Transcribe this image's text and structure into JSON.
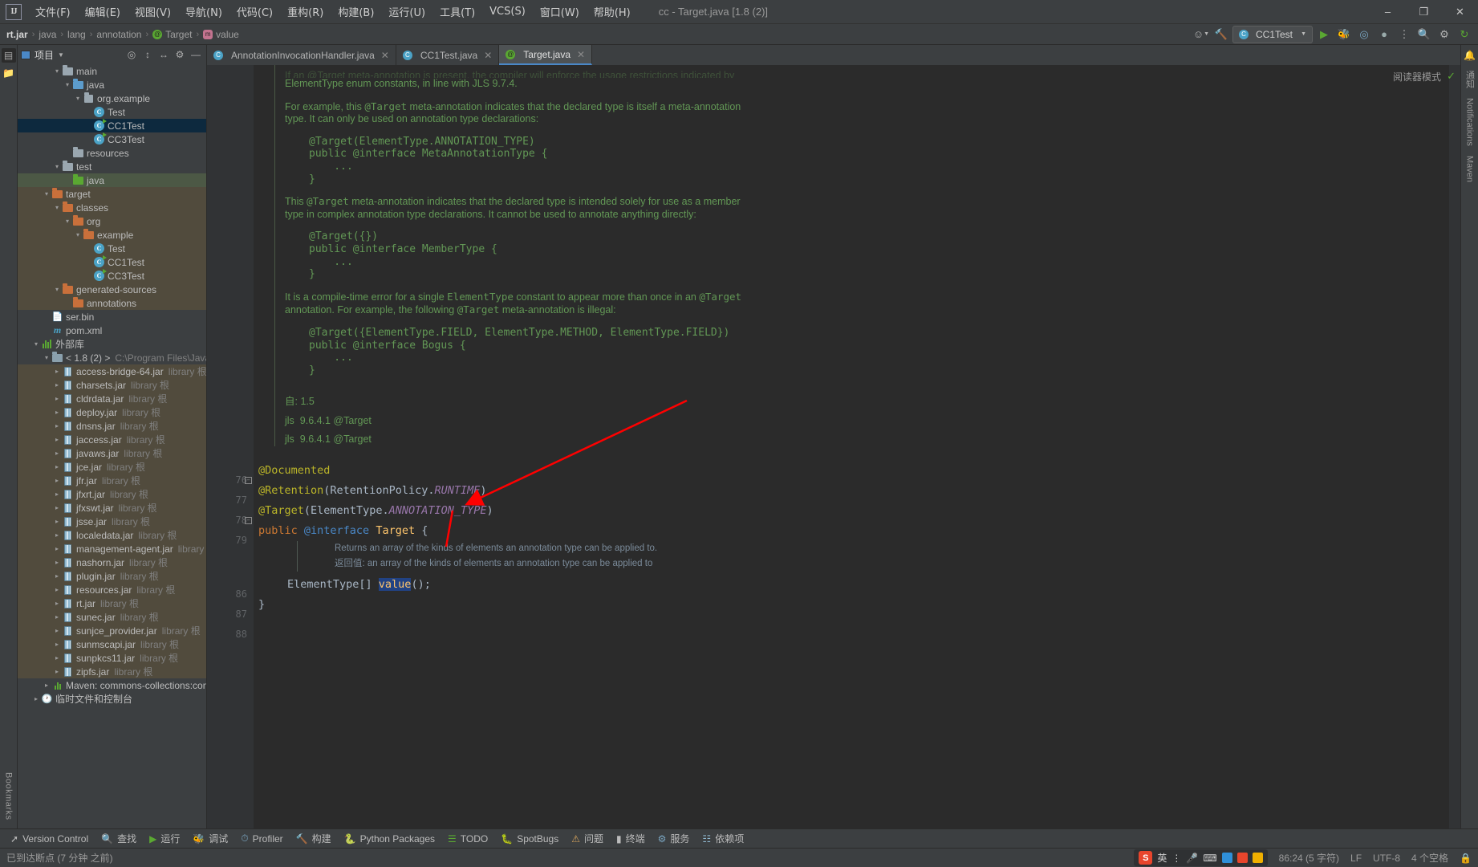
{
  "titlebar": {
    "logo": "IJ",
    "menus": [
      "文件(F)",
      "编辑(E)",
      "视图(V)",
      "导航(N)",
      "代码(C)",
      "重构(R)",
      "构建(B)",
      "运行(U)",
      "工具(T)",
      "VCS(S)",
      "窗口(W)",
      "帮助(H)"
    ],
    "window_title": "cc - Target.java [1.8 (2)]",
    "minimize": "–",
    "maximize": "❐",
    "close": "✕"
  },
  "navbar": {
    "breadcrumbs": [
      {
        "label": "rt.jar",
        "icon": "",
        "bold": true
      },
      {
        "label": "java",
        "icon": ""
      },
      {
        "label": "lang",
        "icon": ""
      },
      {
        "label": "annotation",
        "icon": ""
      },
      {
        "label": "Target",
        "icon": "annotation-icon"
      },
      {
        "label": "value",
        "icon": "method-icon"
      }
    ],
    "separator": "›",
    "run_config": "CC1Test",
    "icons": {
      "profile": "☺",
      "hammer": "⚒",
      "run": "▶",
      "debug": "🐞",
      "coverage": "◉",
      "more": "⋯",
      "search": "🔍",
      "settings": "⚙",
      "updates": "↻"
    }
  },
  "project_panel": {
    "title": "项目",
    "actions": [
      "target-icon",
      "collapse-all-icon",
      "expand-icon",
      "settings-icon",
      "hide-icon"
    ],
    "tree": [
      {
        "indent": 3,
        "arrow": "v",
        "icon": "folder-gray",
        "label": "main",
        "sub": ""
      },
      {
        "indent": 4,
        "arrow": "v",
        "icon": "folder-blue",
        "label": "java",
        "sub": ""
      },
      {
        "indent": 5,
        "arrow": "v",
        "icon": "package-gray",
        "label": "org.example",
        "sub": ""
      },
      {
        "indent": 6,
        "arrow": "",
        "icon": "class",
        "label": "Test",
        "sub": ""
      },
      {
        "indent": 6,
        "arrow": "",
        "icon": "class-run",
        "label": "CC1Test",
        "sub": "",
        "state": "selected"
      },
      {
        "indent": 6,
        "arrow": "",
        "icon": "class-run",
        "label": "CC3Test",
        "sub": ""
      },
      {
        "indent": 4,
        "arrow": "",
        "icon": "folder-resources",
        "label": "resources",
        "sub": ""
      },
      {
        "indent": 3,
        "arrow": "v",
        "icon": "folder-gray",
        "label": "test",
        "sub": ""
      },
      {
        "indent": 4,
        "arrow": "",
        "icon": "folder-green",
        "label": "java",
        "sub": "",
        "state": "green"
      },
      {
        "indent": 2,
        "arrow": "v",
        "icon": "folder-orange",
        "label": "target",
        "sub": "",
        "state": "brown"
      },
      {
        "indent": 3,
        "arrow": "v",
        "icon": "folder-orange",
        "label": "classes",
        "sub": "",
        "state": "brown"
      },
      {
        "indent": 4,
        "arrow": "v",
        "icon": "folder-orange",
        "label": "org",
        "sub": "",
        "state": "brown"
      },
      {
        "indent": 5,
        "arrow": "v",
        "icon": "folder-orange",
        "label": "example",
        "sub": "",
        "state": "brown"
      },
      {
        "indent": 6,
        "arrow": "",
        "icon": "class",
        "label": "Test",
        "sub": "",
        "state": "brown"
      },
      {
        "indent": 6,
        "arrow": "",
        "icon": "class-run",
        "label": "CC1Test",
        "sub": "",
        "state": "brown"
      },
      {
        "indent": 6,
        "arrow": "",
        "icon": "class-run",
        "label": "CC3Test",
        "sub": "",
        "state": "brown"
      },
      {
        "indent": 3,
        "arrow": "v",
        "icon": "folder-orange",
        "label": "generated-sources",
        "sub": "",
        "state": "brown"
      },
      {
        "indent": 4,
        "arrow": "",
        "icon": "folder-orange",
        "label": "annotations",
        "sub": "",
        "state": "brown"
      },
      {
        "indent": 2,
        "arrow": "",
        "icon": "binfile",
        "label": "ser.bin",
        "sub": ""
      },
      {
        "indent": 2,
        "arrow": "",
        "icon": "maven-m",
        "label": "pom.xml",
        "sub": ""
      },
      {
        "indent": 1,
        "arrow": "v",
        "icon": "library-bars",
        "label": "外部库",
        "sub": ""
      },
      {
        "indent": 2,
        "arrow": "v",
        "icon": "jdk",
        "label": "< 1.8 (2) >",
        "sub": "C:\\Program Files\\Java\\jdk"
      },
      {
        "indent": 3,
        "arrow": ">",
        "icon": "jar",
        "label": "access-bridge-64.jar",
        "sub": "library 根",
        "state": "brown"
      },
      {
        "indent": 3,
        "arrow": ">",
        "icon": "jar",
        "label": "charsets.jar",
        "sub": "library 根",
        "state": "brown"
      },
      {
        "indent": 3,
        "arrow": ">",
        "icon": "jar",
        "label": "cldrdata.jar",
        "sub": "library 根",
        "state": "brown"
      },
      {
        "indent": 3,
        "arrow": ">",
        "icon": "jar",
        "label": "deploy.jar",
        "sub": "library 根",
        "state": "brown"
      },
      {
        "indent": 3,
        "arrow": ">",
        "icon": "jar",
        "label": "dnsns.jar",
        "sub": "library 根",
        "state": "brown"
      },
      {
        "indent": 3,
        "arrow": ">",
        "icon": "jar",
        "label": "jaccess.jar",
        "sub": "library 根",
        "state": "brown"
      },
      {
        "indent": 3,
        "arrow": ">",
        "icon": "jar",
        "label": "javaws.jar",
        "sub": "library 根",
        "state": "brown"
      },
      {
        "indent": 3,
        "arrow": ">",
        "icon": "jar",
        "label": "jce.jar",
        "sub": "library 根",
        "state": "brown"
      },
      {
        "indent": 3,
        "arrow": ">",
        "icon": "jar",
        "label": "jfr.jar",
        "sub": "library 根",
        "state": "brown"
      },
      {
        "indent": 3,
        "arrow": ">",
        "icon": "jar",
        "label": "jfxrt.jar",
        "sub": "library 根",
        "state": "brown"
      },
      {
        "indent": 3,
        "arrow": ">",
        "icon": "jar",
        "label": "jfxswt.jar",
        "sub": "library 根",
        "state": "brown"
      },
      {
        "indent": 3,
        "arrow": ">",
        "icon": "jar",
        "label": "jsse.jar",
        "sub": "library 根",
        "state": "brown"
      },
      {
        "indent": 3,
        "arrow": ">",
        "icon": "jar",
        "label": "localedata.jar",
        "sub": "library 根",
        "state": "brown"
      },
      {
        "indent": 3,
        "arrow": ">",
        "icon": "jar",
        "label": "management-agent.jar",
        "sub": "library 根",
        "state": "brown"
      },
      {
        "indent": 3,
        "arrow": ">",
        "icon": "jar",
        "label": "nashorn.jar",
        "sub": "library 根",
        "state": "brown"
      },
      {
        "indent": 3,
        "arrow": ">",
        "icon": "jar",
        "label": "plugin.jar",
        "sub": "library 根",
        "state": "brown"
      },
      {
        "indent": 3,
        "arrow": ">",
        "icon": "jar",
        "label": "resources.jar",
        "sub": "library 根",
        "state": "brown"
      },
      {
        "indent": 3,
        "arrow": ">",
        "icon": "jar",
        "label": "rt.jar",
        "sub": "library 根",
        "state": "brown"
      },
      {
        "indent": 3,
        "arrow": ">",
        "icon": "jar",
        "label": "sunec.jar",
        "sub": "library 根",
        "state": "brown"
      },
      {
        "indent": 3,
        "arrow": ">",
        "icon": "jar",
        "label": "sunjce_provider.jar",
        "sub": "library 根",
        "state": "brown"
      },
      {
        "indent": 3,
        "arrow": ">",
        "icon": "jar",
        "label": "sunmscapi.jar",
        "sub": "library 根",
        "state": "brown"
      },
      {
        "indent": 3,
        "arrow": ">",
        "icon": "jar",
        "label": "sunpkcs11.jar",
        "sub": "library 根",
        "state": "brown"
      },
      {
        "indent": 3,
        "arrow": ">",
        "icon": "jar",
        "label": "zipfs.jar",
        "sub": "library 根",
        "state": "brown"
      },
      {
        "indent": 2,
        "arrow": ">",
        "icon": "maven-lib",
        "label": "Maven: commons-collections:commo",
        "sub": ""
      },
      {
        "indent": 1,
        "arrow": ">",
        "icon": "scratches",
        "label": "临时文件和控制台",
        "sub": ""
      }
    ]
  },
  "left_rail": {
    "icons": [
      "project-structure-icon",
      "folder-icon"
    ],
    "vertical_label": "Bookmarks"
  },
  "right_rail": {
    "labels": [
      "通知",
      "Notifications",
      "Maven"
    ],
    "top_label": "通知"
  },
  "tabs": [
    {
      "label": "AnnotationInvocationHandler.java",
      "icon": "class-icon",
      "active": false,
      "close": "✕"
    },
    {
      "label": "CC1Test.java",
      "icon": "class-run-icon",
      "active": false,
      "close": "✕"
    },
    {
      "label": "Target.java",
      "icon": "annotation-icon",
      "active": true,
      "close": "✕"
    }
  ],
  "editor": {
    "reader_mode_label": "阅读器模式",
    "check_icon": "✓",
    "javadoc": {
      "clipped_first_line": "If an @Target meta-annotation is present, the compiler will enforce the usage restrictions indicated by",
      "line2": "ElementType enum constants, in line with JLS 9.7.4.",
      "para1_a": "For example, this ",
      "para1_mono": "@Target",
      "para1_b": " meta-annotation indicates that the declared type is itself a meta-annotation",
      "para1_c": "type. It can only be used on annotation type declarations:",
      "code1": "@Target(ElementType.ANNOTATION_TYPE)\npublic @interface MetaAnnotationType {\n    ...\n}",
      "para2_a": "This ",
      "para2_mono": "@Target",
      "para2_b": " meta-annotation indicates that the declared type is intended solely for use as a member",
      "para2_c": "type in complex annotation type declarations. It cannot be used to annotate anything directly:",
      "code2": "@Target({})\npublic @interface MemberType {\n    ...\n}",
      "para3_a": "It is a compile-time error for a single ",
      "para3_mono1": "ElementType",
      "para3_b": " constant to appear more than once in an ",
      "para3_mono2": "@Target",
      "para3_c": "annotation. For example, the following ",
      "para3_mono3": "@Target",
      "para3_d": " meta-annotation is illegal:",
      "code3": "@Target({ElementType.FIELD, ElementType.METHOD, ElementType.FIELD})\npublic @interface Bogus {\n    ...\n}",
      "since_label": "自:",
      "since_value": "1.5",
      "jls_tag": "jls",
      "jls1": "9.6.4.1 @Target",
      "jls2": "9.6.4.1 @Target"
    },
    "line_numbers": [
      "76",
      "77",
      "78",
      "79",
      "86",
      "87",
      "88"
    ],
    "code_lines": [
      {
        "num": "76",
        "fold": "minus",
        "tokens": [
          {
            "t": "@Documented",
            "c": "ann"
          }
        ]
      },
      {
        "num": "77",
        "fold": "",
        "tokens": [
          {
            "t": "@Retention",
            "c": "ann"
          },
          {
            "t": "(",
            "c": "paren"
          },
          {
            "t": "RetentionPolicy.",
            "c": "cls"
          },
          {
            "t": "RUNTIME",
            "c": "italicconst"
          },
          {
            "t": ")",
            "c": "paren"
          }
        ]
      },
      {
        "num": "78",
        "fold": "minus",
        "tokens": [
          {
            "t": "@Target",
            "c": "ann"
          },
          {
            "t": "(",
            "c": "paren"
          },
          {
            "t": "ElementType.",
            "c": "cls"
          },
          {
            "t": "ANNOTATION_TYPE",
            "c": "italicconst"
          },
          {
            "t": ")",
            "c": "paren"
          }
        ]
      },
      {
        "num": "79",
        "fold": "",
        "tokens": [
          {
            "t": "public ",
            "c": "kw"
          },
          {
            "t": "@interface ",
            "c": "kw-at"
          },
          {
            "t": "Target ",
            "c": "ident"
          },
          {
            "t": "{",
            "c": "paren"
          }
        ]
      }
    ],
    "param_hints": [
      "Returns an array of the kinds of elements an annotation type can be applied to.",
      "返回值: an array of the kinds of elements an annotation type can be applied to"
    ],
    "method_line": {
      "num": "86",
      "type": "ElementType[] ",
      "name": "value",
      "tail": "();"
    },
    "close_brace_line": {
      "num": "87",
      "text": "}"
    },
    "blank_line": {
      "num": "88",
      "text": ""
    }
  },
  "bottom_tools": [
    {
      "label": "Version Control",
      "icon": "branch-icon"
    },
    {
      "label": "查找",
      "icon": "search-icon"
    },
    {
      "label": "运行",
      "icon": "run-icon"
    },
    {
      "label": "调试",
      "icon": "debug-icon"
    },
    {
      "label": "Profiler",
      "icon": "profiler-icon"
    },
    {
      "label": "构建",
      "icon": "build-icon"
    },
    {
      "label": "Python Packages",
      "icon": "python-icon"
    },
    {
      "label": "TODO",
      "icon": "todo-icon"
    },
    {
      "label": "SpotBugs",
      "icon": "bug-icon"
    },
    {
      "label": "问题",
      "icon": "problems-icon"
    },
    {
      "label": "终端",
      "icon": "terminal-icon"
    },
    {
      "label": "服务",
      "icon": "services-icon"
    },
    {
      "label": "依赖项",
      "icon": "dependencies-icon"
    }
  ],
  "statusbar": {
    "message": "已到达断点 (7 分钟 之前)",
    "caret": "86:24 (5 字符)",
    "line_sep": "LF",
    "encoding": "UTF-8",
    "indent": "4 个空格",
    "lock_icon": "🔒"
  },
  "ime": {
    "lang": "英",
    "icons": [
      "menu-icon",
      "mic-icon",
      "keyboard-icon",
      "palette-icon",
      "cart-icon",
      "star-icon"
    ]
  },
  "colors": {
    "accent": "#4a88c7",
    "selection": "#0d293e",
    "javadoc_green": "#629755",
    "annotation_yellow": "#bbb529",
    "keyword_orange": "#cc7832",
    "identifier_gold": "#ffc66d",
    "constant_purple": "#9876aa",
    "arrow_red": "#ff0000",
    "bg_editor": "#2b2b2b",
    "bg_panel": "#3c3f41"
  }
}
